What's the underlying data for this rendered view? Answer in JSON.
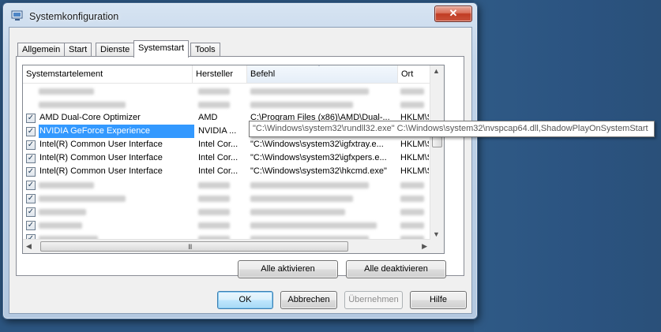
{
  "window": {
    "title": "Systemkonfiguration",
    "close_symbol": "✕"
  },
  "tabs": [
    {
      "label": "Allgemein"
    },
    {
      "label": "Start"
    },
    {
      "label": "Dienste"
    },
    {
      "label": "Systemstart",
      "active": true
    },
    {
      "label": "Tools"
    }
  ],
  "list": {
    "columns": [
      "Systemstartelement",
      "Hersteller",
      "Befehl",
      "Ort"
    ],
    "rows": [
      {
        "checked": false,
        "blurred": true
      },
      {
        "checked": false,
        "blurred": true
      },
      {
        "checked": true,
        "name": "AMD Dual-Core Optimizer",
        "maker": "AMD",
        "cmd": "C:\\Program Files (x86)\\AMD\\Dual-...",
        "loc": "HKLM\\S"
      },
      {
        "checked": true,
        "name": "NVIDIA GeForce Experience",
        "maker": "NVIDIA ...",
        "cmd": "",
        "loc": "",
        "selected": true
      },
      {
        "checked": true,
        "name": "Intel(R) Common User Interface",
        "maker": "Intel Cor...",
        "cmd": "\"C:\\Windows\\system32\\igfxtray.e...",
        "loc": "HKLM\\S"
      },
      {
        "checked": true,
        "name": "Intel(R) Common User Interface",
        "maker": "Intel Cor...",
        "cmd": "\"C:\\Windows\\system32\\igfxpers.e...",
        "loc": "HKLM\\S"
      },
      {
        "checked": true,
        "name": "Intel(R) Common User Interface",
        "maker": "Intel Cor...",
        "cmd": "\"C:\\Windows\\system32\\hkcmd.exe\"",
        "loc": "HKLM\\S"
      },
      {
        "checked": true,
        "blurred": true
      },
      {
        "checked": true,
        "blurred": true
      },
      {
        "checked": true,
        "blurred": true
      },
      {
        "checked": true,
        "blurred": true
      },
      {
        "checked": true,
        "blurred": true
      }
    ],
    "check_symbol": "✓"
  },
  "tooltip": "\"C:\\Windows\\system32\\rundll32.exe\" C:\\Windows\\system32\\nvspcap64.dll,ShadowPlayOnSystemStart",
  "buttons": {
    "enable_all": "Alle aktivieren",
    "disable_all": "Alle deaktivieren",
    "ok": "OK",
    "cancel": "Abbrechen",
    "apply": "Übernehmen",
    "help": "Hilfe"
  },
  "scroll": {
    "grip": "III",
    "up": "▲",
    "down": "▼",
    "left": "◀",
    "right": "▶"
  }
}
